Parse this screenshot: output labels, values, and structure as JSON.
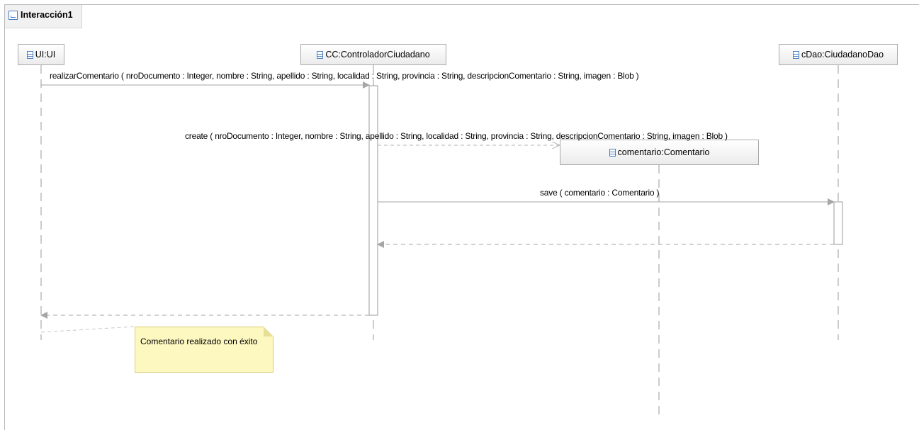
{
  "diagram": {
    "title": "Interacción1",
    "lifelines": {
      "ui": "UI:UI",
      "controller": "CC:ControladorCiudadano",
      "dao": "cDao:CiudadanoDao",
      "comentario": "comentario:Comentario"
    },
    "messages": {
      "realizar": "realizarComentario ( nroDocumento : Integer, nombre : String, apellido : String, localidad : String, provincia : String, descripcionComentario : String, imagen : Blob )",
      "create": "create ( nroDocumento : Integer, nombre : String, apellido : String, localidad : String, provincia : String, descripcionComentario : String, imagen : Blob )",
      "save": "save ( comentario : Comentario )"
    },
    "note": "Comentario realizado con éxito"
  },
  "colors": {
    "line": "#9a9a9a",
    "arrow": "#a6a6a6",
    "note_fill": "#fdf7c0",
    "icon": "#4a7fc1"
  }
}
